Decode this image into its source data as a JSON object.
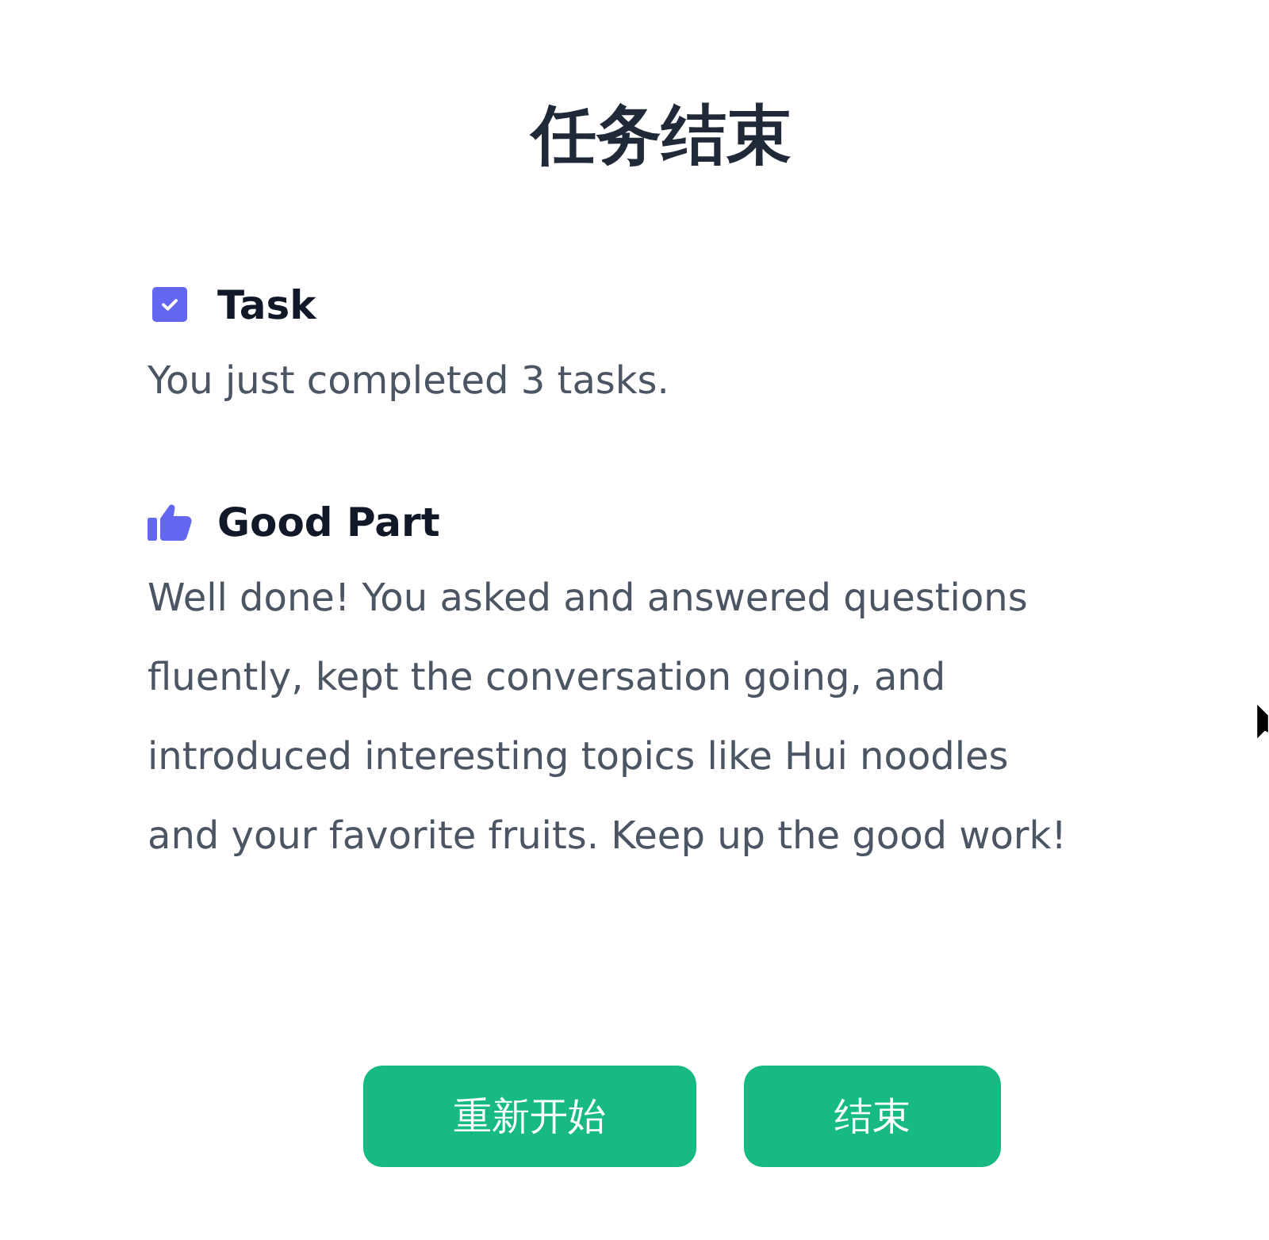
{
  "title": "任务结束",
  "sections": [
    {
      "kind": "task",
      "heading": "Task",
      "body": "You just completed 3 tasks."
    },
    {
      "kind": "praise",
      "heading": "Good Part",
      "body": "Well done! You asked and answered questions fluently, kept the conversation going, and introduced interesting topics like Hui noodles and your favorite fruits. Keep up the good work!"
    }
  ],
  "buttons": [
    {
      "label": "重新开始"
    },
    {
      "label": "结束"
    }
  ]
}
